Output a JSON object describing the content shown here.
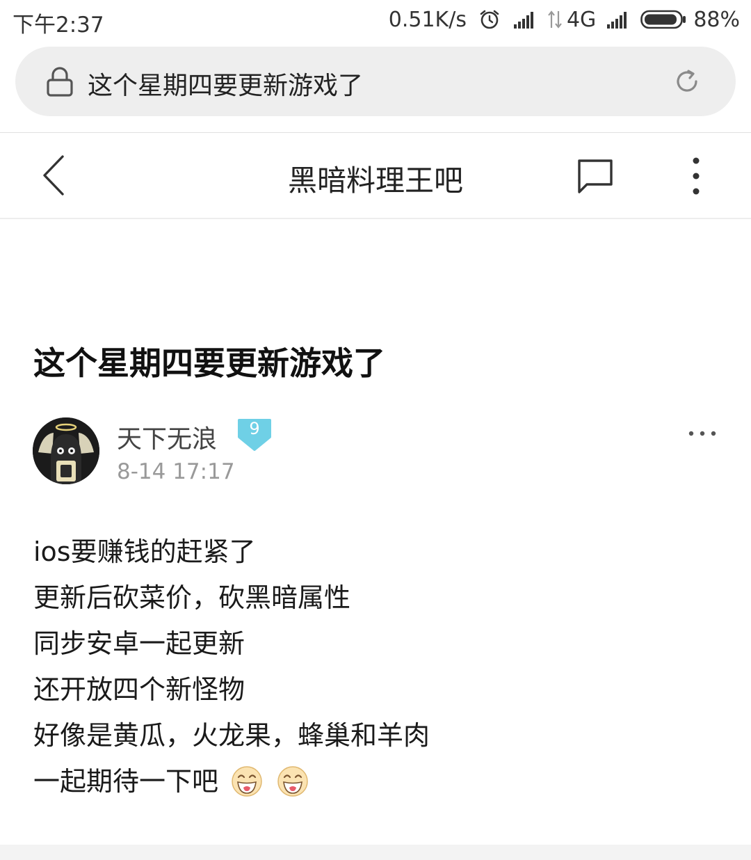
{
  "status_bar": {
    "time": "下午2:37",
    "net_speed": "0.51K/s",
    "net_type": "4G",
    "battery": "88%"
  },
  "url_bar": {
    "text": "这个星期四要更新游戏了"
  },
  "header": {
    "title": "黑暗料理王吧"
  },
  "post": {
    "title": "这个星期四要更新游戏了",
    "author": "天下无浪",
    "level": "9",
    "time": "8-14 17:17",
    "lines": [
      "ios要赚钱的赶紧了",
      "更新后砍菜价，砍黑暗属性",
      "同步安卓一起更新",
      "还开放四个新怪物",
      "好像是黄瓜，火龙果，蜂巢和羊肉",
      "一起期待一下吧"
    ]
  },
  "colors": {
    "level_badge": "#6fd0e6",
    "url_bar_bg": "#eeeeee"
  },
  "icons": [
    "alarm-icon",
    "signal-icon",
    "battery-icon",
    "lock-icon",
    "reload-icon",
    "back-icon",
    "comment-icon",
    "more-icon",
    "emoji-icon"
  ]
}
